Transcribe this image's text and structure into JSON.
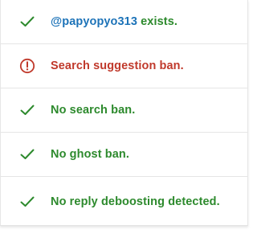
{
  "colors": {
    "success": "#2d8a2d",
    "error": "#c0392b",
    "link": "#1d73b8"
  },
  "results": [
    {
      "icon": "checkmark-icon",
      "status": "ok",
      "handle": "@papyopyo313",
      "label": " exists."
    },
    {
      "icon": "alert-circle-icon",
      "status": "warn",
      "label": "Search suggestion ban."
    },
    {
      "icon": "checkmark-icon",
      "status": "ok",
      "label": "No search ban."
    },
    {
      "icon": "checkmark-icon",
      "status": "ok",
      "label": "No ghost ban."
    },
    {
      "icon": "checkmark-icon",
      "status": "ok",
      "label": "No reply deboosting detected."
    }
  ]
}
